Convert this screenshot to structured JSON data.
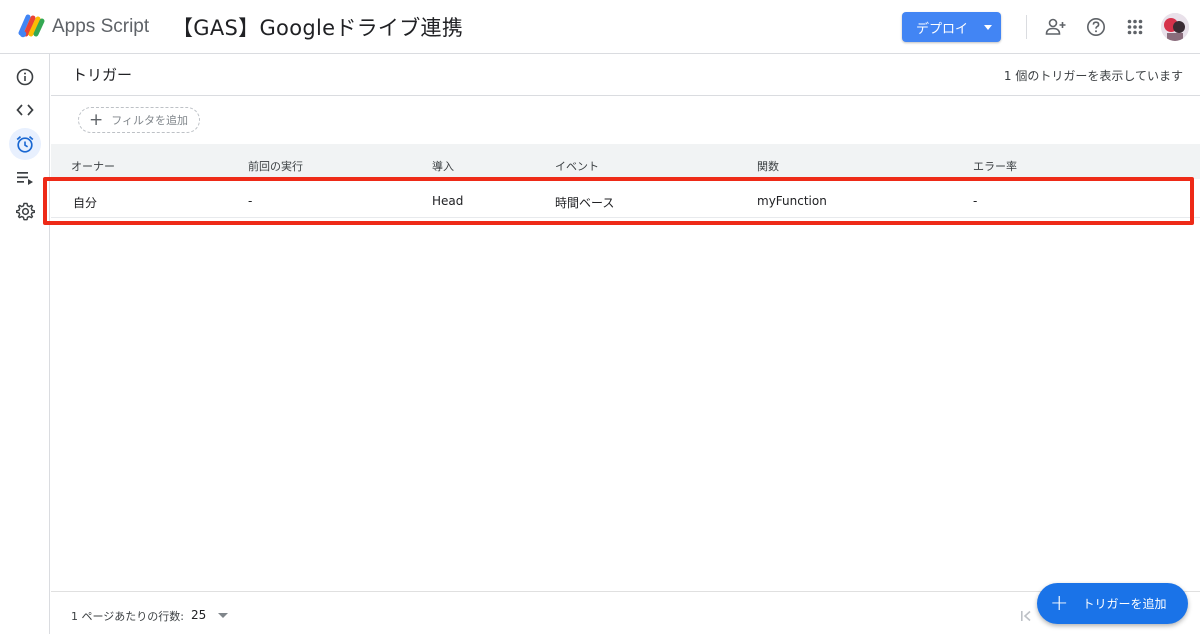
{
  "header": {
    "app_name": "Apps Script",
    "project_title": "【GAS】Googleドライブ連携",
    "deploy_label": "デプロイ",
    "icons": [
      "add-collaborator-icon",
      "help-icon",
      "apps-grid-icon",
      "avatar"
    ]
  },
  "sidebar": {
    "items": [
      {
        "icon": "info-icon",
        "name": "overview"
      },
      {
        "icon": "code-icon",
        "name": "editor"
      },
      {
        "icon": "alarm-clock-icon",
        "name": "triggers",
        "active": true
      },
      {
        "icon": "executions-icon",
        "name": "executions"
      },
      {
        "icon": "settings-gear-icon",
        "name": "settings"
      }
    ]
  },
  "main": {
    "title": "トリガー",
    "count_text": "1 個のトリガーを表示しています",
    "filter_label": "フィルタを追加",
    "columns": [
      "オーナー",
      "前回の実行",
      "導入",
      "イベント",
      "関数",
      "エラー率"
    ],
    "rows": [
      {
        "owner": "自分",
        "last_run": "-",
        "deployment": "Head",
        "event": "時間ベース",
        "function": "myFunction",
        "error_rate": "-"
      }
    ]
  },
  "footer": {
    "rows_per_page_label": "1 ページあたりの行数:",
    "rows_per_page_value": "25",
    "add_trigger_label": "トリガーを追加"
  },
  "colors": {
    "accent": "#1a73e8",
    "deploy_button": "#4285f4",
    "highlight_border": "#ee2a17",
    "active_nav_bg": "#e8f0fe"
  }
}
